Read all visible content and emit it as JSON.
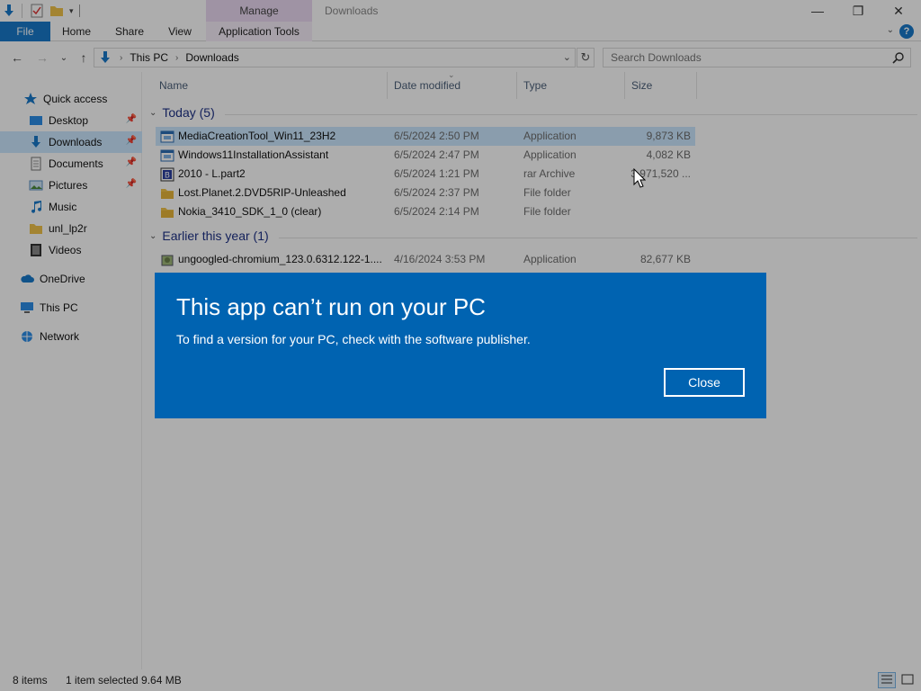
{
  "titlebar": {
    "manage_label": "Manage",
    "window_title": "Downloads",
    "minimize_glyph": "—",
    "maximize_glyph": "❐",
    "close_glyph": "✕"
  },
  "ribbon": {
    "tabs": [
      "File",
      "Home",
      "Share",
      "View",
      "Application Tools"
    ],
    "help_glyph": "?",
    "collapse_glyph": "⌄"
  },
  "address": {
    "back_glyph": "←",
    "forward_glyph": "→",
    "recent_glyph": "⌄",
    "up_glyph": "↑",
    "breadcrumb": [
      "This PC",
      "Downloads"
    ],
    "dropdown_glyph": "⌄",
    "refresh_glyph": "↻",
    "search_placeholder": "Search Downloads"
  },
  "navpane": {
    "items": [
      {
        "label": "Quick access",
        "icon": "star-icon"
      },
      {
        "label": "Desktop",
        "icon": "desktop-icon",
        "pinned": true
      },
      {
        "label": "Downloads",
        "icon": "download-arrow-icon",
        "pinned": true
      },
      {
        "label": "Documents",
        "icon": "document-icon",
        "pinned": true
      },
      {
        "label": "Pictures",
        "icon": "pictures-icon",
        "pinned": true
      },
      {
        "label": "Music",
        "icon": "music-note-icon"
      },
      {
        "label": "unl_lp2r",
        "icon": "folder-icon"
      },
      {
        "label": "Videos",
        "icon": "video-icon"
      },
      {
        "label": "OneDrive",
        "icon": "cloud-icon"
      },
      {
        "label": "This PC",
        "icon": "computer-icon"
      },
      {
        "label": "Network",
        "icon": "network-icon"
      }
    ]
  },
  "columns": {
    "name": "Name",
    "date": "Date modified",
    "type": "Type",
    "size": "Size"
  },
  "groups": [
    {
      "title": "Today (5)",
      "files": [
        {
          "name": "MediaCreationTool_Win11_23H2",
          "date": "6/5/2024 2:50 PM",
          "type": "Application",
          "size": "9,873 KB",
          "icon": "app-icon"
        },
        {
          "name": "Windows11InstallationAssistant",
          "date": "6/5/2024 2:47 PM",
          "type": "Application",
          "size": "4,082 KB",
          "icon": "app-icon"
        },
        {
          "name": "2010 - L.part2",
          "date": "6/5/2024 1:21 PM",
          "type": "rar Archive",
          "size": "3,971,520 ...",
          "icon": "rar-archive-icon"
        },
        {
          "name": "Lost.Planet.2.DVD5RIP-Unleashed",
          "date": "6/5/2024 2:37 PM",
          "type": "File folder",
          "size": "",
          "icon": "folder-icon"
        },
        {
          "name": "Nokia_3410_SDK_1_0 (clear)",
          "date": "6/5/2024 2:14 PM",
          "type": "File folder",
          "size": "",
          "icon": "folder-icon"
        }
      ]
    },
    {
      "title": "Earlier this year (1)",
      "files": [
        {
          "name": "ungoogled-chromium_123.0.6312.122-1....",
          "date": "4/16/2024 3:53 PM",
          "type": "Application",
          "size": "82,677 KB",
          "icon": "installer-icon"
        }
      ]
    }
  ],
  "status": {
    "items_count": "8 items",
    "selection": "1 item selected  9.64 MB"
  },
  "dialog": {
    "title": "This app can’t run on your PC",
    "message": "To find a version for your PC, check with the software publisher.",
    "close_label": "Close"
  },
  "colors": {
    "accent": "#1979ca",
    "dialog_bg": "#0063b1",
    "selection": "#cce8ff",
    "group_header": "#1e3287"
  }
}
